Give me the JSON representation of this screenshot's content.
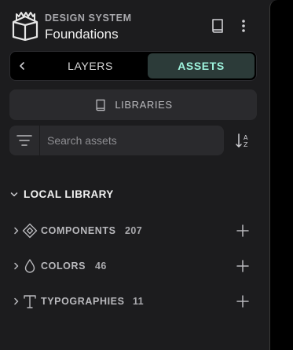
{
  "header": {
    "project_type": "DESIGN SYSTEM",
    "project_name": "Foundations",
    "icons": {
      "logo": "building-icon",
      "book": "book-icon",
      "more": "more-vertical-icon"
    }
  },
  "tabs": {
    "back_icon": "chevron-left-icon",
    "items": [
      {
        "label": "LAYERS",
        "active": false
      },
      {
        "label": "ASSETS",
        "active": true
      }
    ]
  },
  "libraries_button": {
    "label": "LIBRARIES",
    "icon": "book-icon"
  },
  "search": {
    "value": "",
    "placeholder": "Search assets",
    "filter_icon": "filter-icon",
    "sort_icon": "sort-alpha-icon"
  },
  "local_library": {
    "title": "LOCAL LIBRARY",
    "expanded": true,
    "groups": [
      {
        "label": "COMPONENTS",
        "count": "207",
        "icon": "component-icon"
      },
      {
        "label": "COLORS",
        "count": "46",
        "icon": "drop-icon"
      },
      {
        "label": "TYPOGRAPHIES",
        "count": "11",
        "icon": "text-icon"
      }
    ]
  },
  "colors": {
    "panel_bg": "#1c1c1e",
    "surface": "#2a2a2d",
    "accent": "#9ef3dd",
    "accent_bg": "#2c3b39"
  }
}
